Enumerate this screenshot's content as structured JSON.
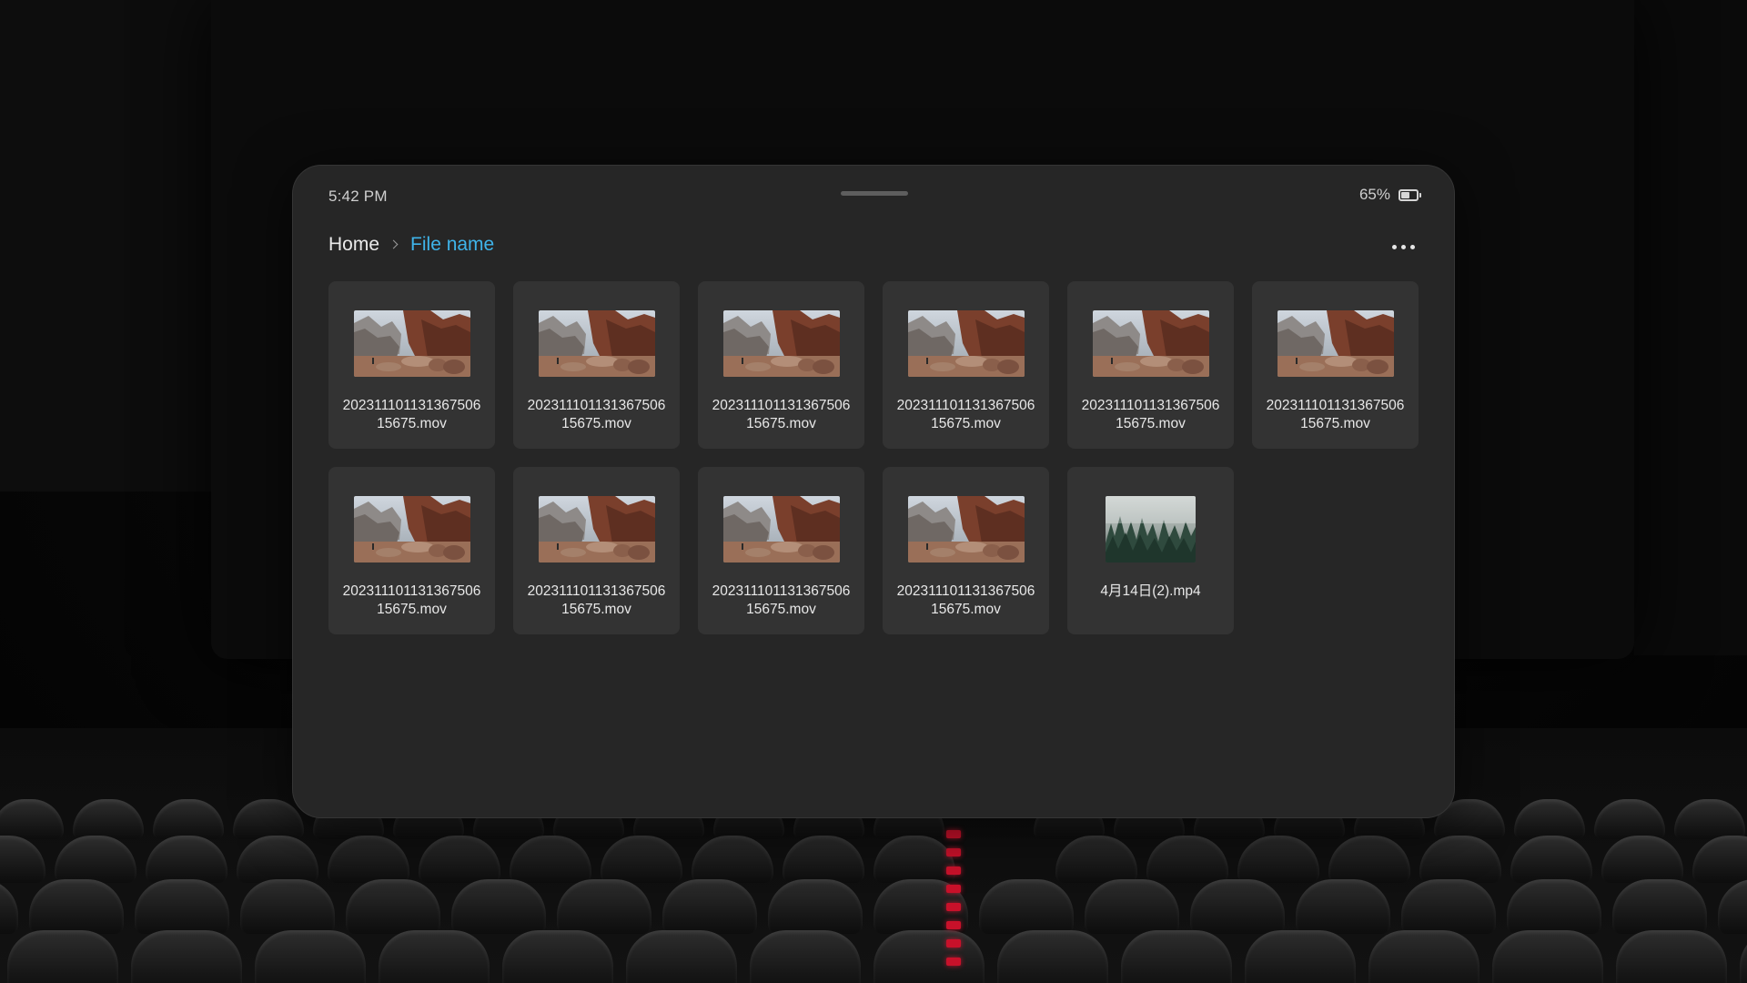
{
  "status_bar": {
    "time": "5:42 PM",
    "battery_percent_label": "65%",
    "battery_level": 0.65
  },
  "breadcrumb": {
    "home": "Home",
    "current": "File name"
  },
  "colors": {
    "accent": "#3fb4ea",
    "window_bg": "#262626",
    "card_bg": "#333333"
  },
  "files": [
    {
      "line1": "202311101131367506",
      "line2": "15675.mov",
      "thumbnail": "canyon"
    },
    {
      "line1": "202311101131367506",
      "line2": "15675.mov",
      "thumbnail": "canyon"
    },
    {
      "line1": "202311101131367506",
      "line2": "15675.mov",
      "thumbnail": "canyon"
    },
    {
      "line1": "202311101131367506",
      "line2": "15675.mov",
      "thumbnail": "canyon"
    },
    {
      "line1": "202311101131367506",
      "line2": "15675.mov",
      "thumbnail": "canyon"
    },
    {
      "line1": "202311101131367506",
      "line2": "15675.mov",
      "thumbnail": "canyon"
    },
    {
      "line1": "202311101131367506",
      "line2": "15675.mov",
      "thumbnail": "canyon"
    },
    {
      "line1": "202311101131367506",
      "line2": "15675.mov",
      "thumbnail": "canyon"
    },
    {
      "line1": "202311101131367506",
      "line2": "15675.mov",
      "thumbnail": "canyon"
    },
    {
      "line1": "202311101131367506",
      "line2": "15675.mov",
      "thumbnail": "canyon"
    },
    {
      "line1": "4月14日(2).mp4",
      "line2": "",
      "thumbnail": "forest"
    }
  ],
  "icons": {
    "more": "more-horizontal-icon",
    "battery": "battery-icon",
    "chevron": "chevron-right-icon"
  }
}
